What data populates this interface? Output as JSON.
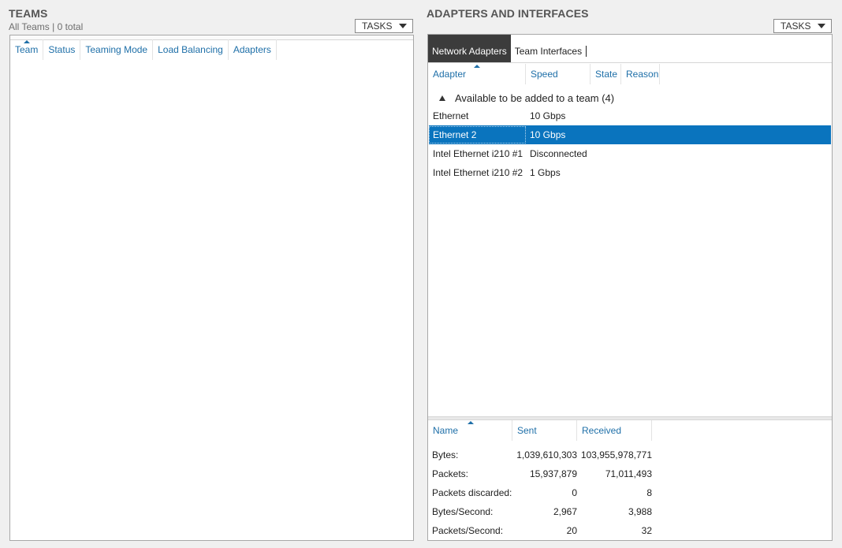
{
  "teams": {
    "title": "TEAMS",
    "subtitle": "All Teams | 0 total",
    "tasks_label": "TASKS",
    "columns": [
      "Team",
      "Status",
      "Teaming Mode",
      "Load Balancing",
      "Adapters"
    ]
  },
  "adapters": {
    "title": "ADAPTERS AND INTERFACES",
    "tasks_label": "TASKS",
    "tabs": [
      "Network Adapters",
      "Team Interfaces"
    ],
    "columns": [
      "Adapter",
      "Speed",
      "State",
      "Reason"
    ],
    "group_label": "Available to be added to a team (4)",
    "rows": [
      {
        "adapter": "Ethernet",
        "speed": "10 Gbps",
        "selected": false
      },
      {
        "adapter": "Ethernet 2",
        "speed": "10 Gbps",
        "selected": true
      },
      {
        "adapter": "Intel Ethernet i210 #1",
        "speed": "Disconnected",
        "selected": false
      },
      {
        "adapter": "Intel Ethernet i210 #2",
        "speed": "1 Gbps",
        "selected": false
      }
    ],
    "stats_columns": [
      "Name",
      "Sent",
      "Received"
    ],
    "stats": [
      {
        "name": "Bytes:",
        "sent": "1,039,610,303",
        "received": "103,955,978,771"
      },
      {
        "name": "Packets:",
        "sent": "15,937,879",
        "received": "71,011,493"
      },
      {
        "name": "Packets discarded:",
        "sent": "0",
        "received": "8"
      },
      {
        "name": "Bytes/Second:",
        "sent": "2,967",
        "received": "3,988"
      },
      {
        "name": "Packets/Second:",
        "sent": "20",
        "received": "32"
      }
    ]
  },
  "colors": {
    "selection": "#0a74be",
    "header_text": "#1e6fa8",
    "active_tab": "#3c3c3c"
  }
}
